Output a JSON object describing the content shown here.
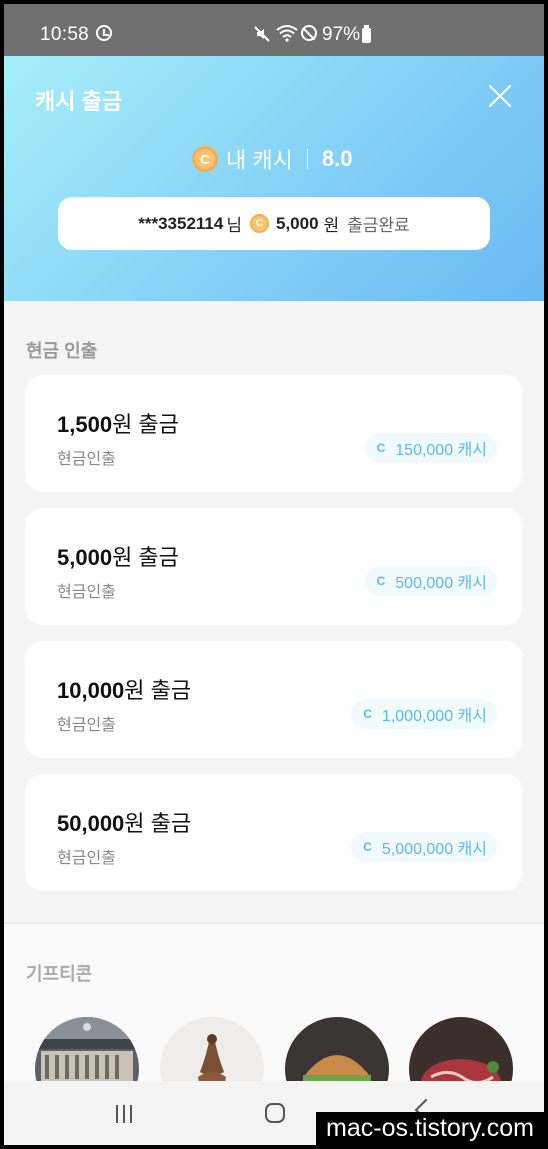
{
  "status_bar": {
    "time": "10:58",
    "battery": "97%"
  },
  "header": {
    "title": "캐시 출금",
    "coin_symbol": "C",
    "my_cash_label": "내 캐시",
    "my_cash_value": "8.0",
    "notice": {
      "user": "***3352114",
      "suffix": "님",
      "amount": "5,000",
      "unit": "원",
      "status": "출금완료"
    }
  },
  "cash_section": {
    "title": "현금 인출",
    "items": [
      {
        "amount": "1,500",
        "label": "원 출금",
        "sub": "현금인출",
        "badge_symbol": "C",
        "cost": "150,000 캐시"
      },
      {
        "amount": "5,000",
        "label": "원 출금",
        "sub": "현금인출",
        "badge_symbol": "C",
        "cost": "500,000 캐시"
      },
      {
        "amount": "10,000",
        "label": "원 출금",
        "sub": "현금인출",
        "badge_symbol": "C",
        "cost": "1,000,000 캐시"
      },
      {
        "amount": "50,000",
        "label": "원 출금",
        "sub": "현금인출",
        "badge_symbol": "C",
        "cost": "5,000,000 캐시"
      }
    ]
  },
  "gift_section": {
    "title": "기프티콘",
    "items": [
      {
        "icon": "store-photo"
      },
      {
        "icon": "dessert-photo"
      },
      {
        "icon": "burger-photo"
      },
      {
        "icon": "steak-photo"
      }
    ]
  },
  "watermark": "mac-os.tistory.com",
  "colors": {
    "header_start": "#a6eef8",
    "header_end": "#6ab8f3",
    "badge_text": "#5fb9e6",
    "coin": "#f8c271"
  }
}
